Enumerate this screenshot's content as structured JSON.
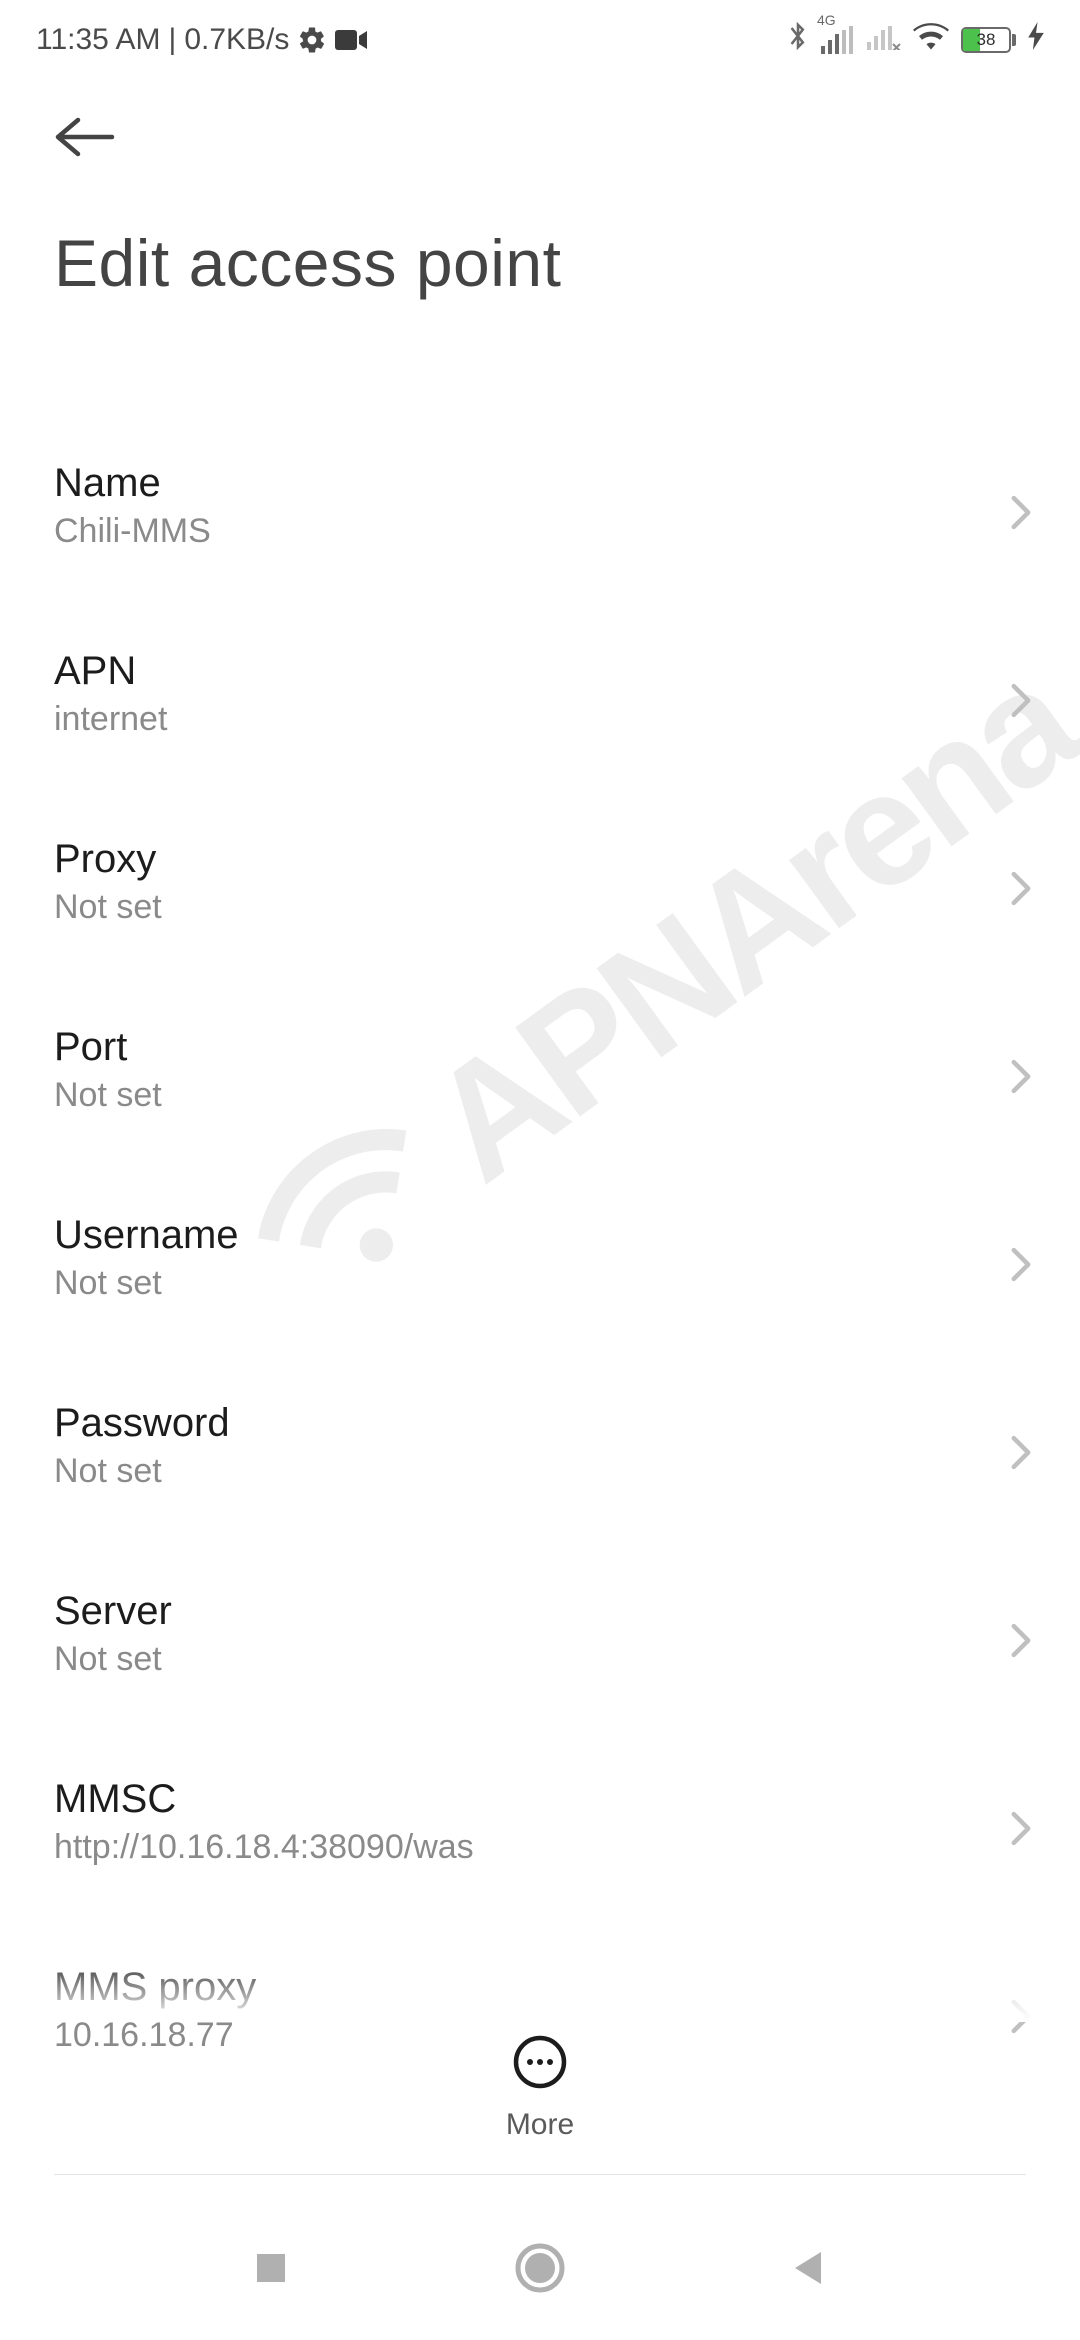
{
  "status": {
    "time": "11:35 AM",
    "net_speed": "0.7KB/s",
    "network_badge": "4G",
    "battery_pct": "38"
  },
  "header": {
    "title": "Edit access point"
  },
  "rows": [
    {
      "label": "Name",
      "value": "Chili-MMS"
    },
    {
      "label": "APN",
      "value": "internet"
    },
    {
      "label": "Proxy",
      "value": "Not set"
    },
    {
      "label": "Port",
      "value": "Not set"
    },
    {
      "label": "Username",
      "value": "Not set"
    },
    {
      "label": "Password",
      "value": "Not set"
    },
    {
      "label": "Server",
      "value": "Not set"
    },
    {
      "label": "MMSC",
      "value": "http://10.16.18.4:38090/was"
    },
    {
      "label": "MMS proxy",
      "value": "10.16.18.77"
    }
  ],
  "bottom": {
    "more_label": "More"
  },
  "watermark": {
    "text": "APNArena"
  }
}
